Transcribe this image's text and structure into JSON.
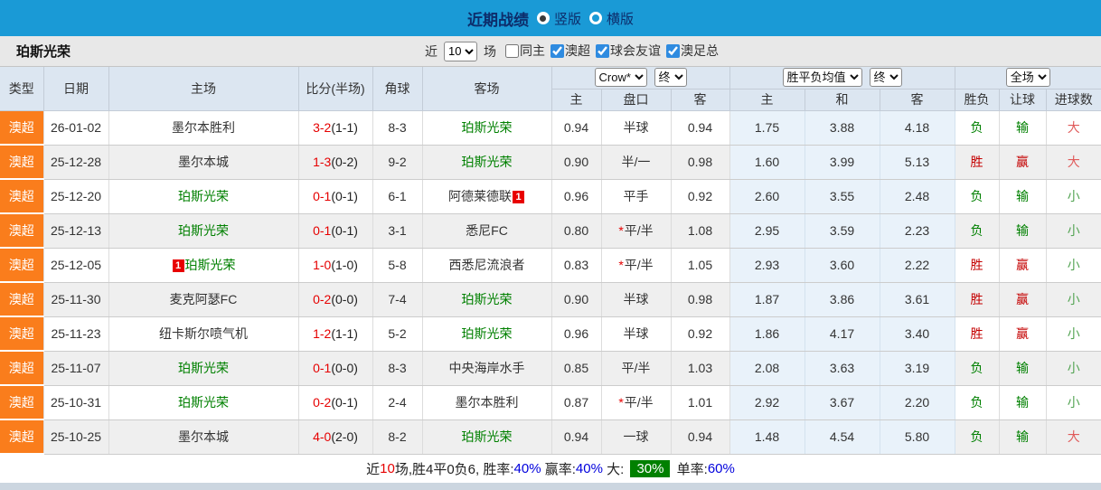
{
  "topbar": {
    "title": "近期战绩",
    "options": [
      {
        "label": "竖版",
        "selected": true
      },
      {
        "label": "横版",
        "selected": false
      }
    ]
  },
  "filterbar": {
    "team": "珀斯光荣",
    "recent_label": "近",
    "recent_value": "10",
    "unit_label": "场",
    "checkboxes": [
      {
        "label": "同主",
        "checked": false
      },
      {
        "label": "澳超",
        "checked": true
      },
      {
        "label": "球会友谊",
        "checked": true
      },
      {
        "label": "澳足总",
        "checked": true
      }
    ]
  },
  "table": {
    "left_headers": [
      "类型",
      "日期",
      "主场",
      "比分(半场)",
      "角球",
      "客场"
    ],
    "sub_headers": [
      "主",
      "盘口",
      "客",
      "主",
      "和",
      "客",
      "胜负",
      "让球",
      "进球数"
    ],
    "selects": {
      "odds_company": "Crow*",
      "odds_state": "终",
      "avg_label": "胜平负均值",
      "avg_state": "终",
      "scope": "全场"
    },
    "rows": [
      {
        "league": "澳超",
        "date": "26-01-02",
        "home": {
          "name": "墨尔本胜利",
          "green": false,
          "badge": null
        },
        "score": "3-2",
        "half": "(1-1)",
        "corner": "8-3",
        "away": {
          "name": "珀斯光荣",
          "green": true,
          "badge": null
        },
        "odds_home": "0.94",
        "handicap": "半球",
        "star": false,
        "odds_away": "0.94",
        "avg": [
          "1.75",
          "3.88",
          "4.18"
        ],
        "result": "负",
        "spread": "输",
        "goals": "大"
      },
      {
        "league": "澳超",
        "date": "25-12-28",
        "home": {
          "name": "墨尔本城",
          "green": false,
          "badge": null
        },
        "score": "1-3",
        "half": "(0-2)",
        "corner": "9-2",
        "away": {
          "name": "珀斯光荣",
          "green": true,
          "badge": null
        },
        "odds_home": "0.90",
        "handicap": "半/一",
        "star": false,
        "odds_away": "0.98",
        "avg": [
          "1.60",
          "3.99",
          "5.13"
        ],
        "result": "胜",
        "spread": "赢",
        "goals": "大"
      },
      {
        "league": "澳超",
        "date": "25-12-20",
        "home": {
          "name": "珀斯光荣",
          "green": true,
          "badge": null
        },
        "score": "0-1",
        "half": "(0-1)",
        "corner": "6-1",
        "away": {
          "name": "阿德莱德联",
          "green": false,
          "badge": "1"
        },
        "odds_home": "0.96",
        "handicap": "平手",
        "star": false,
        "odds_away": "0.92",
        "avg": [
          "2.60",
          "3.55",
          "2.48"
        ],
        "result": "负",
        "spread": "输",
        "goals": "小"
      },
      {
        "league": "澳超",
        "date": "25-12-13",
        "home": {
          "name": "珀斯光荣",
          "green": true,
          "badge": null
        },
        "score": "0-1",
        "half": "(0-1)",
        "corner": "3-1",
        "away": {
          "name": "悉尼FC",
          "green": false,
          "badge": null
        },
        "odds_home": "0.80",
        "handicap": "平/半",
        "star": true,
        "odds_away": "1.08",
        "avg": [
          "2.95",
          "3.59",
          "2.23"
        ],
        "result": "负",
        "spread": "输",
        "goals": "小"
      },
      {
        "league": "澳超",
        "date": "25-12-05",
        "home": {
          "name": "珀斯光荣",
          "green": true,
          "badge": "1"
        },
        "score": "1-0",
        "half": "(1-0)",
        "corner": "5-8",
        "away": {
          "name": "西悉尼流浪者",
          "green": false,
          "badge": null
        },
        "odds_home": "0.83",
        "handicap": "平/半",
        "star": true,
        "odds_away": "1.05",
        "avg": [
          "2.93",
          "3.60",
          "2.22"
        ],
        "result": "胜",
        "spread": "赢",
        "goals": "小"
      },
      {
        "league": "澳超",
        "date": "25-11-30",
        "home": {
          "name": "麦克阿瑟FC",
          "green": false,
          "badge": null
        },
        "score": "0-2",
        "half": "(0-0)",
        "corner": "7-4",
        "away": {
          "name": "珀斯光荣",
          "green": true,
          "badge": null
        },
        "odds_home": "0.90",
        "handicap": "半球",
        "star": false,
        "odds_away": "0.98",
        "avg": [
          "1.87",
          "3.86",
          "3.61"
        ],
        "result": "胜",
        "spread": "赢",
        "goals": "小"
      },
      {
        "league": "澳超",
        "date": "25-11-23",
        "home": {
          "name": "纽卡斯尔喷气机",
          "green": false,
          "badge": null
        },
        "score": "1-2",
        "half": "(1-1)",
        "corner": "5-2",
        "away": {
          "name": "珀斯光荣",
          "green": true,
          "badge": null
        },
        "odds_home": "0.96",
        "handicap": "半球",
        "star": false,
        "odds_away": "0.92",
        "avg": [
          "1.86",
          "4.17",
          "3.40"
        ],
        "result": "胜",
        "spread": "赢",
        "goals": "小"
      },
      {
        "league": "澳超",
        "date": "25-11-07",
        "home": {
          "name": "珀斯光荣",
          "green": true,
          "badge": null
        },
        "score": "0-1",
        "half": "(0-0)",
        "corner": "8-3",
        "away": {
          "name": "中央海岸水手",
          "green": false,
          "badge": null
        },
        "odds_home": "0.85",
        "handicap": "平/半",
        "star": false,
        "odds_away": "1.03",
        "avg": [
          "2.08",
          "3.63",
          "3.19"
        ],
        "result": "负",
        "spread": "输",
        "goals": "小"
      },
      {
        "league": "澳超",
        "date": "25-10-31",
        "home": {
          "name": "珀斯光荣",
          "green": true,
          "badge": null
        },
        "score": "0-2",
        "half": "(0-1)",
        "corner": "2-4",
        "away": {
          "name": "墨尔本胜利",
          "green": false,
          "badge": null
        },
        "odds_home": "0.87",
        "handicap": "平/半",
        "star": true,
        "odds_away": "1.01",
        "avg": [
          "2.92",
          "3.67",
          "2.20"
        ],
        "result": "负",
        "spread": "输",
        "goals": "小"
      },
      {
        "league": "澳超",
        "date": "25-10-25",
        "home": {
          "name": "墨尔本城",
          "green": false,
          "badge": null
        },
        "score": "4-0",
        "half": "(2-0)",
        "corner": "8-2",
        "away": {
          "name": "珀斯光荣",
          "green": true,
          "badge": null
        },
        "odds_home": "0.94",
        "handicap": "一球",
        "star": false,
        "odds_away": "0.94",
        "avg": [
          "1.48",
          "4.54",
          "5.80"
        ],
        "result": "负",
        "spread": "输",
        "goals": "大"
      }
    ]
  },
  "summary": {
    "part1": "近",
    "num": "10",
    "part2": "场,胜4平0负6, 胜率:",
    "win_rate": "40%",
    "part3": " 赢率:",
    "spread_rate": "40%",
    "part4": " 大: ",
    "big_rate": "30%",
    "part5": " 单率:",
    "odd_rate": "60%"
  },
  "colors": {
    "topbar_blue": "#1a9ad6",
    "title_navy": "#0d2d6b",
    "league_orange": "#fa7d1c",
    "header_bg": "#dce6f1",
    "avg_col_bg": "#e9f2fa",
    "win_red": "#c40000",
    "lose_green": "#008000",
    "score_red": "#e60000",
    "link_blue": "#0000dd",
    "big_rate_green": "#008000"
  }
}
